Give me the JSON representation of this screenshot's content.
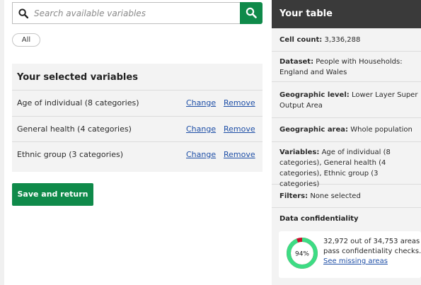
{
  "search": {
    "placeholder": "Search available variables"
  },
  "filter_chip": {
    "label": "All"
  },
  "selected_variables": {
    "title": "Your selected variables",
    "items": [
      {
        "name": "Age of individual (8 categories)",
        "change_label": "Change",
        "remove_label": "Remove"
      },
      {
        "name": "General health (4 categories)",
        "change_label": "Change",
        "remove_label": "Remove"
      },
      {
        "name": "Ethnic group (3 categories)",
        "change_label": "Change",
        "remove_label": "Remove"
      }
    ]
  },
  "save_button": {
    "label": "Save and return"
  },
  "your_table": {
    "title": "Your table",
    "cell_count": {
      "label": "Cell count:",
      "value": "3,336,288"
    },
    "dataset": {
      "label": "Dataset:",
      "value": "People with Households: England and Wales"
    },
    "geographic_level": {
      "label": "Geographic level:",
      "value": "Lower Layer Super Output Area"
    },
    "geographic_area": {
      "label": "Geographic area:",
      "value": "Whole population"
    },
    "variables": {
      "label": "Variables:",
      "value": "Age of individual (8 categories), General health (4 categories), Ethnic group (3 categories)"
    },
    "filters": {
      "label": "Filters:",
      "value": "None selected"
    },
    "confidentiality": {
      "title": "Data confidentiality",
      "percent_label": "94%",
      "pass_fraction": 0.94,
      "summary": "32,972 out of 34,753 areas pass confidentiality checks.",
      "link_label": "See missing areas"
    }
  },
  "colors": {
    "primary_green": "#0f8a4a",
    "header_dark": "#3a3a3a",
    "link_blue": "#1d4ea6",
    "panel_grey": "#f3f3f3",
    "donut_pass": "#3ddc84",
    "donut_fail": "#c8102e"
  },
  "icons": {
    "search_field": "search-icon",
    "search_button": "search-icon"
  }
}
